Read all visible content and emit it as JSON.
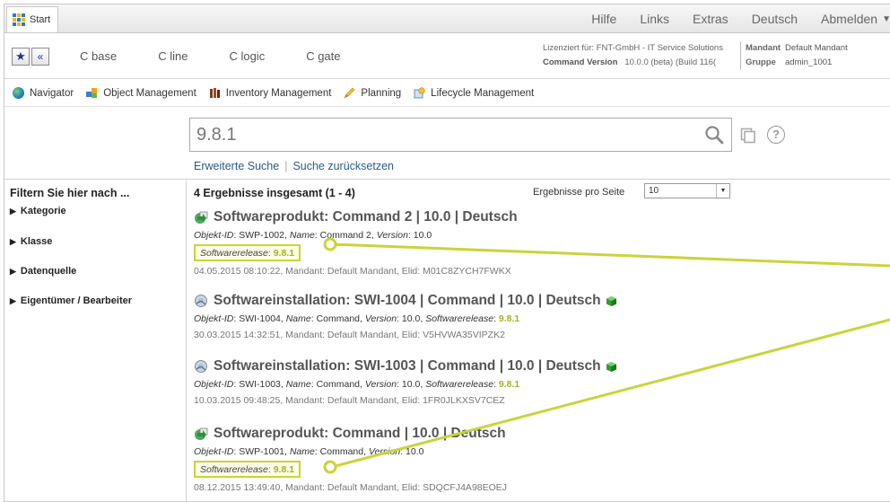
{
  "topbar": {
    "start_label": "Start",
    "menu": [
      "Hilfe",
      "Links",
      "Extras",
      "Deutsch",
      "Abmelden"
    ]
  },
  "toolbar": {
    "modules": [
      "C base",
      "C line",
      "C logic",
      "C gate"
    ],
    "license_label": "Lizenziert für: FNT-GmbH - IT Service Solutions",
    "command_version_label": "Command Version",
    "command_version_value": "10.0.0 (beta) (Build 116(",
    "mandant_label": "Mandant",
    "mandant_value": "Default Mandant",
    "gruppe_label": "Gruppe",
    "gruppe_value": "admin_1001"
  },
  "navbar": {
    "items": [
      "Navigator",
      "Object Management",
      "Inventory Management",
      "Planning",
      "Lifecycle Management"
    ]
  },
  "search": {
    "query": "9.8.1",
    "advanced": "Erweiterte Suche",
    "reset": "Suche zurücksetzen",
    "separator": "|"
  },
  "filter": {
    "title": "Filtern Sie hier nach ...",
    "items": [
      "Kategorie",
      "Klasse",
      "Datenquelle",
      "Eigentümer / Bearbeiter"
    ]
  },
  "results": {
    "count": "4 Ergebnisse insgesamt (1 - 4)",
    "per_page_label": "Ergebnisse pro Seite",
    "per_page_value": "10",
    "entries": [
      {
        "title": "Softwareprodukt: Command 2 | 10.0 | Deutsch",
        "attrs": [
          {
            "k": "Objekt-ID",
            "v": "SWP-1002"
          },
          {
            "k": "Name",
            "v": "Command 2"
          },
          {
            "k": "Version",
            "v": "10.0"
          }
        ],
        "release_label": "Softwarerelease",
        "release_value": "9.8.1",
        "meta": "04.05.2015 08:10:22, Mandant: Default Mandant, Elid: M01C8ZYCH7FWKX"
      },
      {
        "title": "Softwareinstallation: SWI-1004 | Command | 10.0 | Deutsch",
        "attrs": [
          {
            "k": "Objekt-ID",
            "v": "SWI-1004"
          },
          {
            "k": "Name",
            "v": "Command"
          },
          {
            "k": "Version",
            "v": "10.0"
          },
          {
            "k": "Softwarerelease",
            "v": "9.8.1"
          }
        ],
        "meta": "30.03.2015 14:32:51, Mandant: Default Mandant, Elid: V5HVWA35VIPZK2"
      },
      {
        "title": "Softwareinstallation: SWI-1003 | Command | 10.0 | Deutsch",
        "attrs": [
          {
            "k": "Objekt-ID",
            "v": "SWI-1003"
          },
          {
            "k": "Name",
            "v": "Command"
          },
          {
            "k": "Version",
            "v": "10.0"
          },
          {
            "k": "Softwarerelease",
            "v": "9.8.1"
          }
        ],
        "meta": "10.03.2015 09:48:25, Mandant: Default Mandant, Elid: 1FR0JLKXSV7CEZ"
      },
      {
        "title": "Softwareprodukt: Command | 10.0 | Deutsch",
        "attrs": [
          {
            "k": "Objekt-ID",
            "v": "SWP-1001"
          },
          {
            "k": "Name",
            "v": "Command"
          },
          {
            "k": "Version",
            "v": "10.0"
          }
        ],
        "release_label": "Softwarerelease",
        "release_value": "9.8.1",
        "meta": "08.12.2015 13:49:40, Mandant: Default Mandant, Elid: SDQCFJ4A98EOEJ"
      }
    ]
  },
  "colors": {
    "highlight": "#a7b11e",
    "annotation": "#c9d43a",
    "link": "#2a5c8a"
  }
}
